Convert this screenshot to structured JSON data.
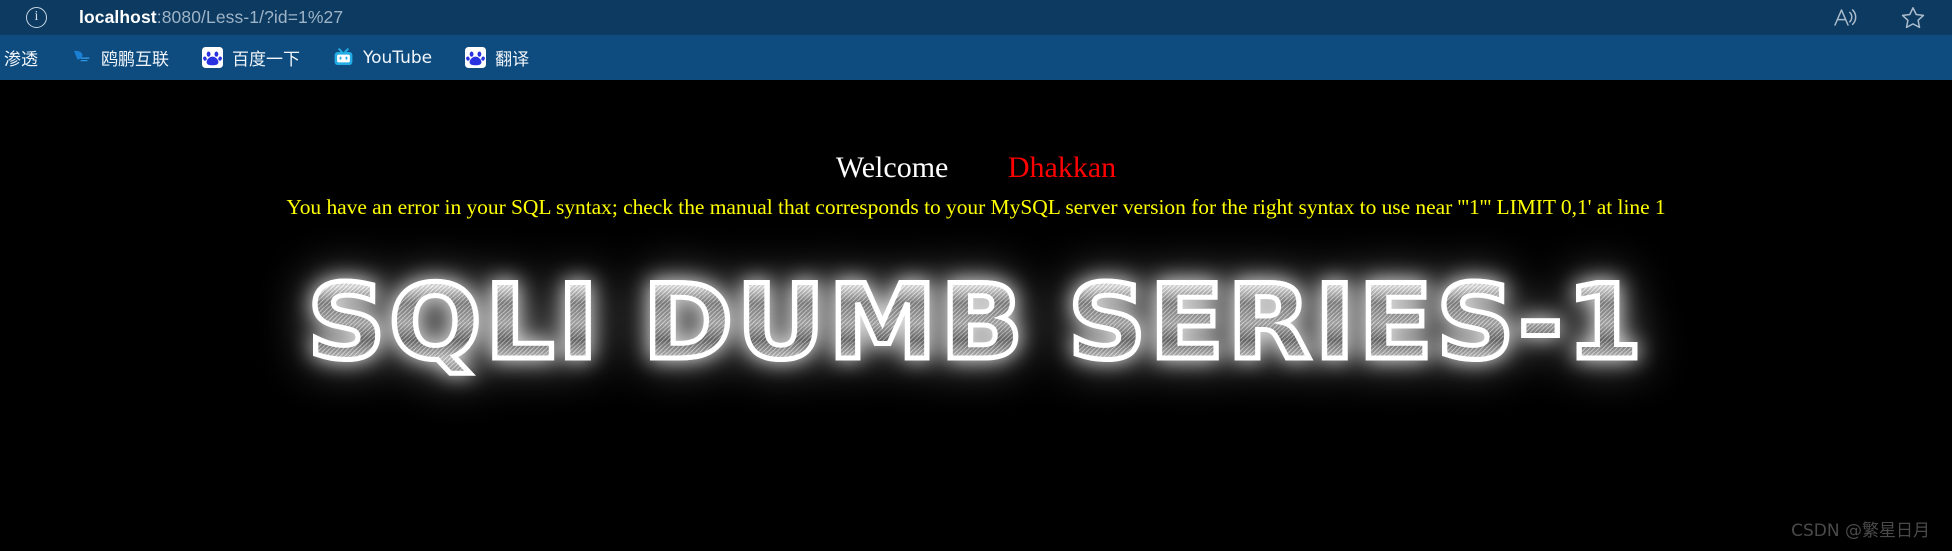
{
  "browser": {
    "toolbar": {
      "info_icon": "info-icon",
      "url_host": "localhost",
      "url_rest": ":8080/Less-1/?id=1%27",
      "url_full": "localhost:8080/Less-1/?id=1%27",
      "right_icons": [
        {
          "name": "read-aloud-icon",
          "label": "Read aloud"
        },
        {
          "name": "favorites-star-icon",
          "label": "Add this page to favorites"
        }
      ]
    },
    "bookmarks": [
      {
        "label": "渗透",
        "icon": "none"
      },
      {
        "label": "鸥鹏互联",
        "icon": "oupeng-logo-icon"
      },
      {
        "label": "百度一下",
        "icon": "baidu-paw-icon"
      },
      {
        "label": "YouTube",
        "icon": "bilibili-tv-icon"
      },
      {
        "label": "翻译",
        "icon": "baidu-paw-icon"
      }
    ]
  },
  "page": {
    "welcome_word": "Welcome",
    "welcome_name": "Dhakkan",
    "sql_error": "You have an error in your SQL syntax; check the manual that corresponds to your MySQL server version for the right syntax to use near '''1''' LIMIT 0,1' at line 1",
    "banner_title": "SQLI DUMB SERIES-1",
    "watermark": "CSDN @繁星日月"
  },
  "colors": {
    "toolbar_bg": "#0d3a61",
    "bookmarks_bg": "#0e4c80",
    "page_bg": "#000000",
    "welcome_text": "#ffffff",
    "name_text": "#ff0000",
    "error_text": "#ffff00",
    "watermark_text": "#4a4a4a"
  }
}
